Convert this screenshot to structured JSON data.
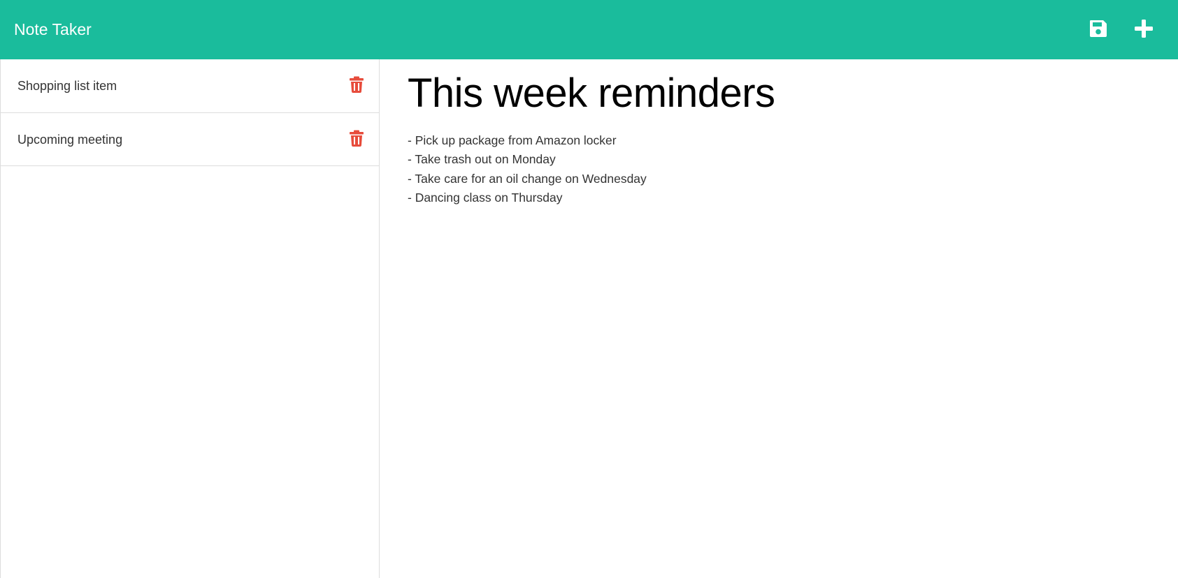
{
  "app": {
    "title": "Note Taker"
  },
  "toolbar": {
    "save_icon": "save-icon",
    "new_icon": "plus-icon",
    "color": "#1abc9c"
  },
  "notes": [
    {
      "title": "Shopping list item",
      "delete_icon": "trash-icon"
    },
    {
      "title": "Upcoming meeting",
      "delete_icon": "trash-icon"
    }
  ],
  "active_note": {
    "title": "This week reminders",
    "lines": [
      "- Pick up package from Amazon locker",
      "- Take trash out on Monday",
      "- Take care for an oil change on Wednesday",
      "- Dancing class on Thursday"
    ]
  },
  "colors": {
    "accent": "#1abc9c",
    "delete": "#e74c3c",
    "text": "#333333"
  }
}
